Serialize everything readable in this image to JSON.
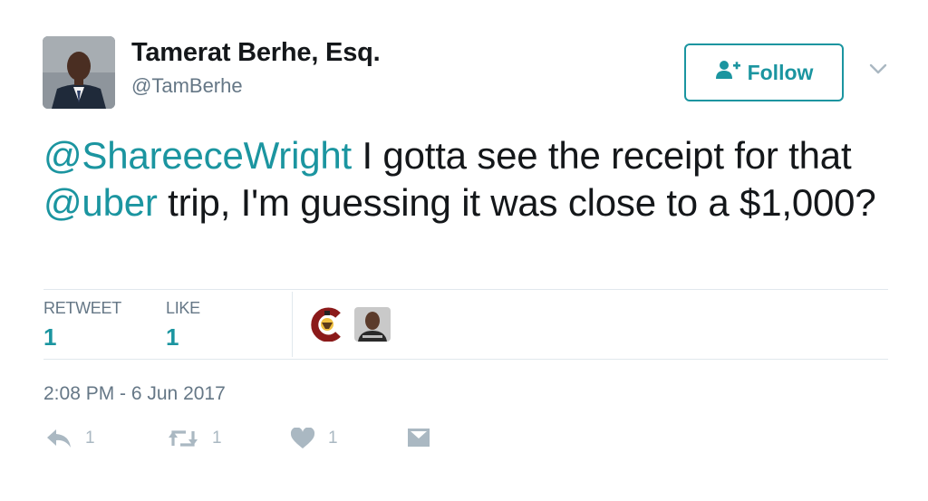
{
  "author": {
    "name": "Tamerat Berhe, Esq.",
    "handle": "@TamBerhe",
    "avatar_icon": "profile-photo"
  },
  "follow_button": {
    "label": "Follow",
    "icon": "add-person-icon"
  },
  "menu": {
    "icon": "chevron-down-icon"
  },
  "tweet": {
    "mention1": "@ShareeceWright",
    "text1": " I gotta see the receipt for that ",
    "mention2": "@uber",
    "text2": " trip, I'm guessing it was close to a $1,000?"
  },
  "stats": {
    "retweet_label": "RETWEET",
    "retweet_count": "1",
    "like_label": "LIKE",
    "like_count": "1"
  },
  "timestamp": "2:08 PM - 6 Jun 2017",
  "actions": {
    "reply_count": "1",
    "retweet_count": "1",
    "like_count": "1"
  },
  "colors": {
    "accent": "#1b95a0",
    "text": "#14171a",
    "secondary": "#657786",
    "icon_gray": "#aab8c2",
    "border": "#e1e8ed"
  }
}
